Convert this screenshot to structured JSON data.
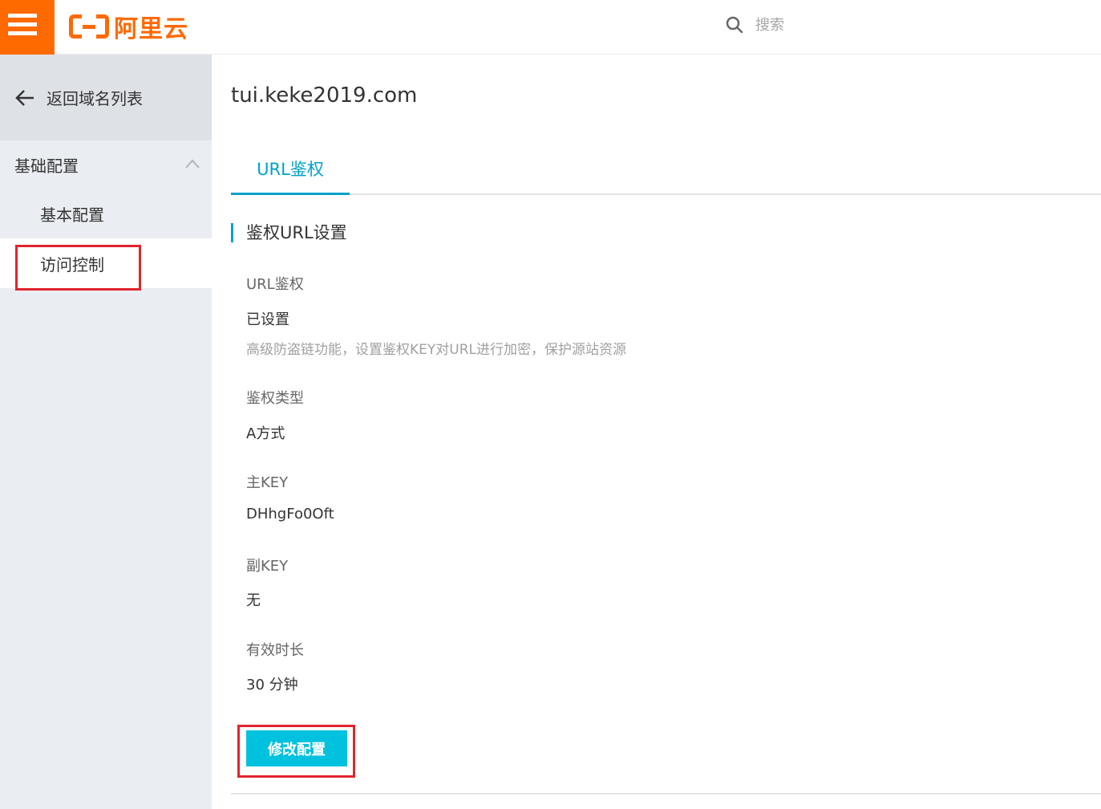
{
  "brand": {
    "name": "阿里云",
    "accent": "#ff6a00"
  },
  "search": {
    "placeholder": "搜索"
  },
  "sidebar": {
    "back_label": "返回域名列表",
    "group_label": "基础配置",
    "items": [
      {
        "label": "基本配置",
        "active": false
      },
      {
        "label": "访问控制",
        "active": true
      }
    ]
  },
  "main": {
    "domain": "tui.keke2019.com",
    "tabs": [
      {
        "label": "URL鉴权",
        "active": true
      }
    ],
    "section_title": "鉴权URL设置",
    "fields": {
      "url_auth": {
        "label": "URL鉴权",
        "value": "已设置",
        "help": "高级防盗链功能，设置鉴权KEY对URL进行加密，保护源站资源"
      },
      "auth_type": {
        "label": "鉴权类型",
        "value": "A方式"
      },
      "primary_key": {
        "label": "主KEY",
        "value": "DHhgFo0Oft"
      },
      "secondary_key": {
        "label": "副KEY",
        "value": "无"
      },
      "valid_duration": {
        "label": "有效时长",
        "value": "30 分钟"
      }
    },
    "edit_button": "修改配置"
  },
  "colors": {
    "tab_accent": "#00a2ca",
    "button": "#00c1de",
    "highlight": "#e0242f"
  }
}
